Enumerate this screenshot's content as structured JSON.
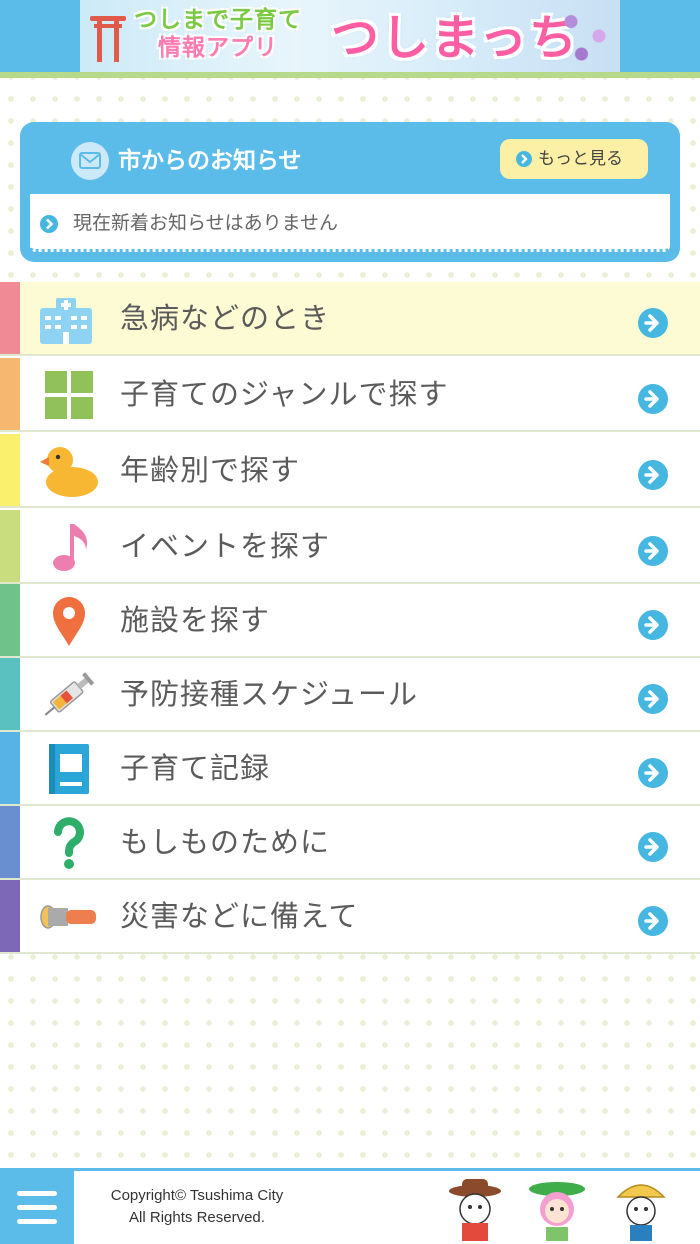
{
  "header": {
    "subtitle_line1": "つしまで子育て",
    "subtitle_line2": "情報アプリ",
    "app_title": "つしまっち"
  },
  "news": {
    "title": "市からのお知らせ",
    "more_label": "もっと見る",
    "message": "現在新着お知らせはありません"
  },
  "menu": {
    "items": [
      {
        "label": "急病などのとき",
        "icon": "hospital-icon",
        "color": "#f08a95"
      },
      {
        "label": "子育てのジャンルで探す",
        "icon": "grid-icon",
        "color": "#f6b770"
      },
      {
        "label": "年齢別で探す",
        "icon": "duck-icon",
        "color": "#fbef6e"
      },
      {
        "label": "イベントを探す",
        "icon": "music-note-icon",
        "color": "#c9dd7e"
      },
      {
        "label": "施設を探す",
        "icon": "map-pin-icon",
        "color": "#6fc28a"
      },
      {
        "label": "予防接種スケジュール",
        "icon": "syringe-icon",
        "color": "#5bc0c0"
      },
      {
        "label": "子育て記録",
        "icon": "notebook-icon",
        "color": "#57b2e6"
      },
      {
        "label": "もしものために",
        "icon": "question-icon",
        "color": "#6a8fd0"
      },
      {
        "label": "災害などに備えて",
        "icon": "flashlight-icon",
        "color": "#7d68b8"
      }
    ]
  },
  "footer": {
    "copyright_line1": "Copyright© Tsushima City",
    "copyright_line2": "All Rights Reserved."
  },
  "colors": {
    "primary": "#5bbce9",
    "accent_yellow": "#fbf0a6",
    "highlight_row": "#fdfbd3",
    "arrow": "#46b7e1"
  }
}
